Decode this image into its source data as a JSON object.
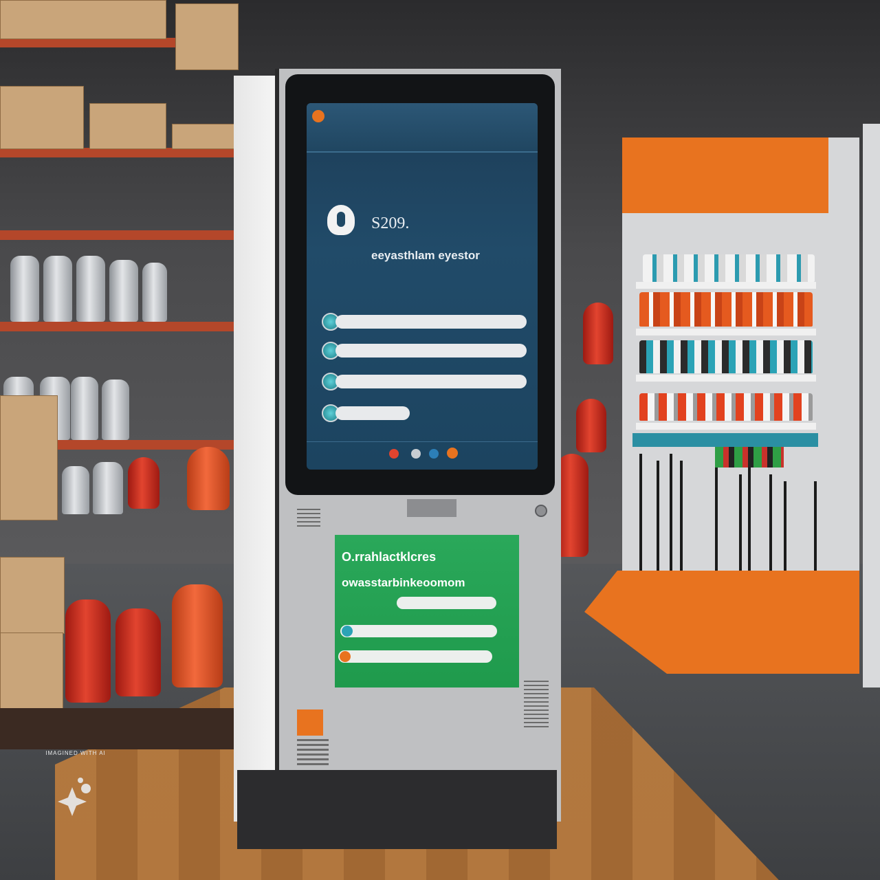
{
  "scene": {
    "kiosk_screen": {
      "header_text_1": "",
      "price": "S209.",
      "subtitle": "eeyasthlam eyestor",
      "section_label": "",
      "menu_items": [
        "",
        "",
        "",
        ""
      ],
      "footer_text": ""
    },
    "kiosk_panel": {
      "title_line_1": "O.rrahlactklcres",
      "title_line_2": "owasstarbinkeoomom",
      "left_label": "",
      "pills": [
        "",
        "",
        ""
      ]
    },
    "colors": {
      "screen_bg": "#1f4864",
      "panel_green": "#22a052",
      "accent_orange": "#e8731f",
      "extinguisher_red": "#c8301f"
    },
    "watermark": "IMAGINED WITH AI"
  }
}
